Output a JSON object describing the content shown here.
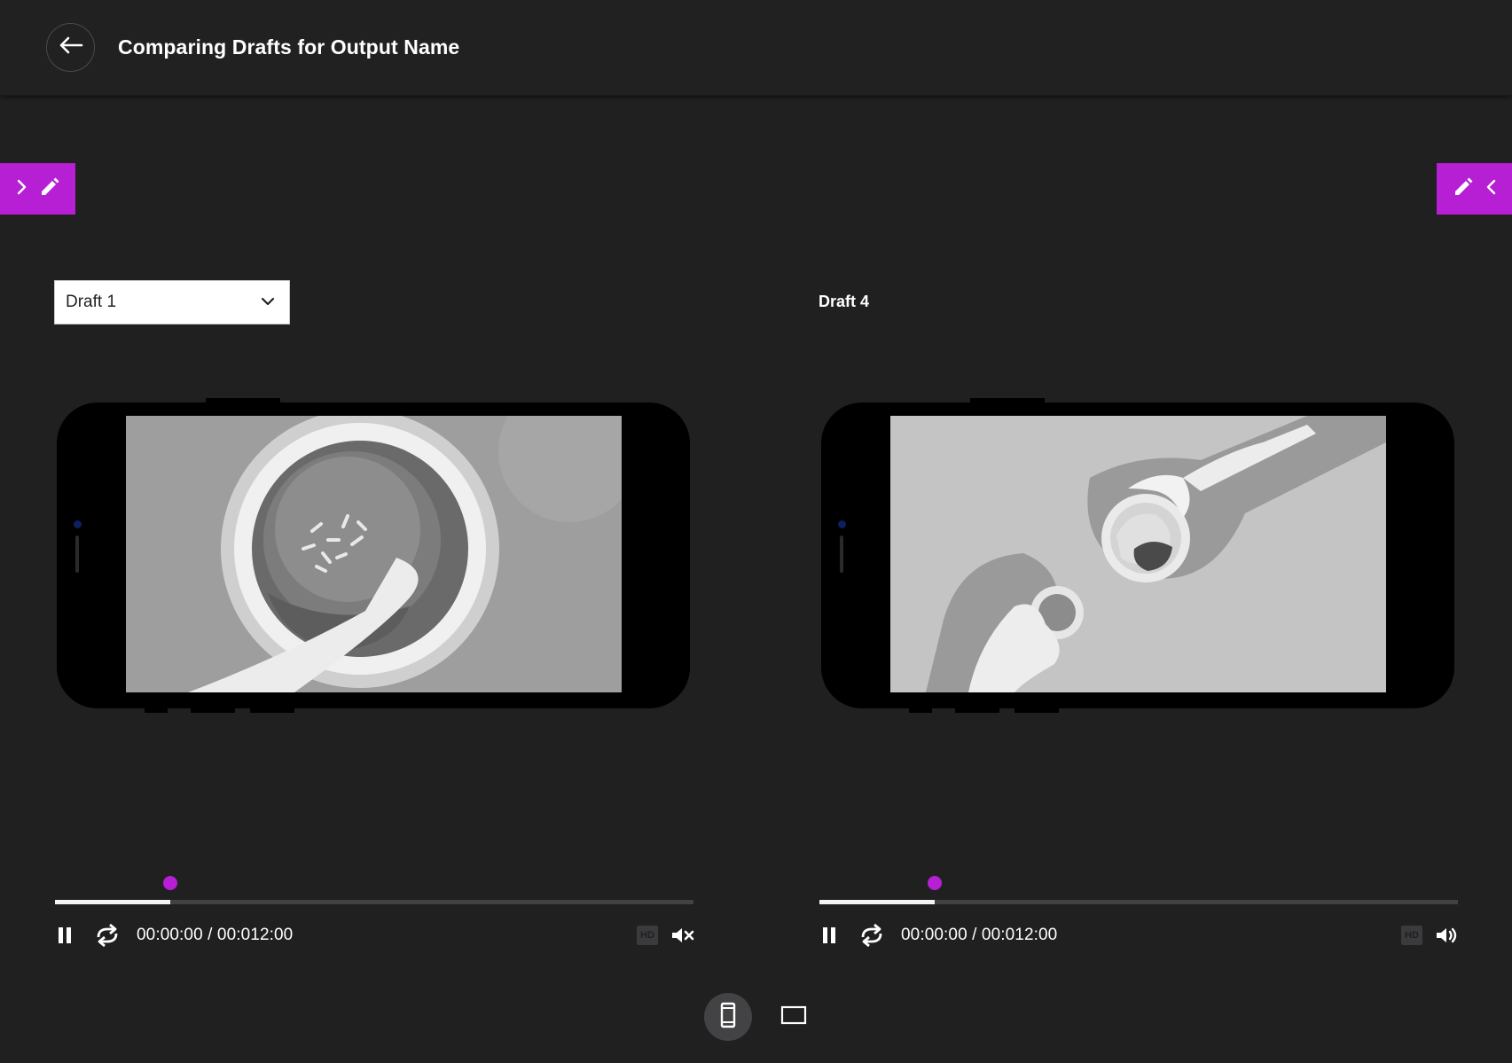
{
  "header": {
    "title": "Comparing Drafts for Output Name",
    "back_icon": "arrow-left-icon"
  },
  "side_tabs": {
    "left": {
      "icons": [
        "chevron-right-icon",
        "pencil-icon"
      ]
    },
    "right": {
      "icons": [
        "pencil-icon",
        "chevron-left-icon"
      ]
    }
  },
  "left_panel": {
    "draft_select": {
      "value": "Draft 1",
      "icon": "chevron-down-icon"
    },
    "player": {
      "time_current": "00:00:00",
      "time_total": "00:012:00",
      "progress": 0.18,
      "hd_label": "HD",
      "volume_state": "muted"
    }
  },
  "right_panel": {
    "draft_label": "Draft 4",
    "player": {
      "time_current": "00:00:00",
      "time_total": "00:012:00",
      "progress": 0.18,
      "hd_label": "HD",
      "volume_state": "on"
    }
  },
  "view_toggle": {
    "options": [
      "mobile-view-icon",
      "desktop-view-icon"
    ],
    "active": "mobile-view-icon"
  },
  "colors": {
    "accent": "#b61fd3",
    "background": "#202021"
  }
}
